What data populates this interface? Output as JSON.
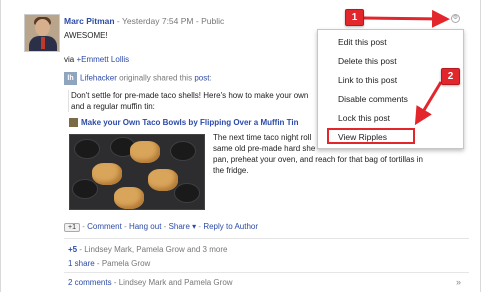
{
  "post": {
    "author": "Marc Pitman",
    "timestamp": "Yesterday 7:54 PM",
    "visibility": "Public",
    "separator": "-",
    "text": "AWESOME!",
    "via_prefix": "via",
    "via_user": "+Emmett Lollis"
  },
  "shared": {
    "logo_letter": "lh",
    "source": "Lifehacker",
    "phrase": "originally shared this",
    "post_link": "post",
    "colon": ":",
    "line1": "Don't settle for pre-made taco shells! Here's how to make your own",
    "line2": "and a regular muffin tin:"
  },
  "article": {
    "title": "Make your Own Taco Bowls by Flipping Over a Muffin Tin",
    "body": [
      "The next time taco night roll",
      "same old pre-made hard she",
      "pan, preheat your oven, and reach for that bag of tortillas in",
      "the fridge."
    ]
  },
  "actions": {
    "plus_one": "+1",
    "comment": "Comment",
    "hangout": "Hang out",
    "share": "Share",
    "share_caret": "▾",
    "reply": "Reply to Author",
    "dash": "-"
  },
  "stats": {
    "plus_count": "+5",
    "plus_people": "Lindsey Mark, Pamela Grow and 3 more",
    "share_count": "1 share",
    "share_people": "Pamela Grow",
    "comments_count": "2 comments",
    "comments_people": "Lindsey Mark and Pamela Grow",
    "expand": "»"
  },
  "menu": {
    "items": [
      "Edit this post",
      "Delete this post",
      "Link to this post",
      "Disable comments",
      "Lock this post",
      "View Ripples"
    ]
  },
  "annotations": {
    "badge1": "1",
    "badge2": "2",
    "color": "#e2262c"
  },
  "icons": {
    "gear": "gear-icon",
    "article": "article-thumbnail-icon"
  }
}
